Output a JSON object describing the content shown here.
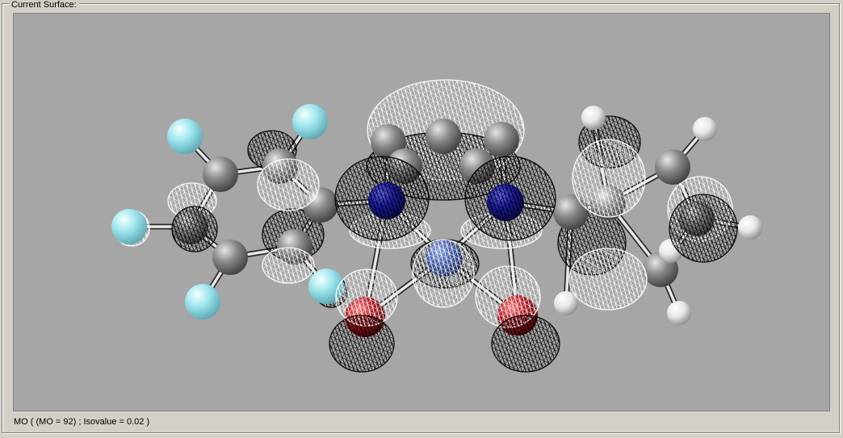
{
  "surface": {
    "group_title": "Current Surface:",
    "status_text": "MO ( (MO = 92) ; Isovalue = 0.02 )"
  },
  "colors": {
    "window_background": "#d4d0c8",
    "viewport_background": "#a6a6a6",
    "carbon_atom": "#7a7a7a",
    "nitrogen_atom": "#1f1fb4",
    "nitrogen_atom_center": "#4a5fa8",
    "oxygen_atom": "#b01c24",
    "fluorine_atom": "#9ee6ee",
    "hydrogen_atom": "#f0f0f0",
    "positive_lobe": "#ffffff",
    "negative_lobe": "#000000"
  },
  "molecule": {
    "atoms": [
      {
        "element": "C"
      },
      {
        "element": "C"
      },
      {
        "element": "C"
      },
      {
        "element": "C"
      },
      {
        "element": "C"
      },
      {
        "element": "C"
      },
      {
        "element": "C"
      },
      {
        "element": "C"
      },
      {
        "element": "C"
      },
      {
        "element": "C"
      },
      {
        "element": "C"
      },
      {
        "element": "C"
      },
      {
        "element": "C"
      },
      {
        "element": "C"
      },
      {
        "element": "C"
      },
      {
        "element": "C"
      },
      {
        "element": "N"
      },
      {
        "element": "N"
      },
      {
        "element": "N"
      },
      {
        "element": "O"
      },
      {
        "element": "O"
      },
      {
        "element": "F"
      },
      {
        "element": "F"
      },
      {
        "element": "F"
      },
      {
        "element": "F"
      },
      {
        "element": "F"
      },
      {
        "element": "H"
      },
      {
        "element": "H"
      },
      {
        "element": "H"
      },
      {
        "element": "H"
      },
      {
        "element": "H"
      },
      {
        "element": "H"
      }
    ]
  },
  "orbital": {
    "mo_number": 92,
    "isovalue": 0.02,
    "lobe_phases": [
      "positive",
      "negative"
    ]
  }
}
